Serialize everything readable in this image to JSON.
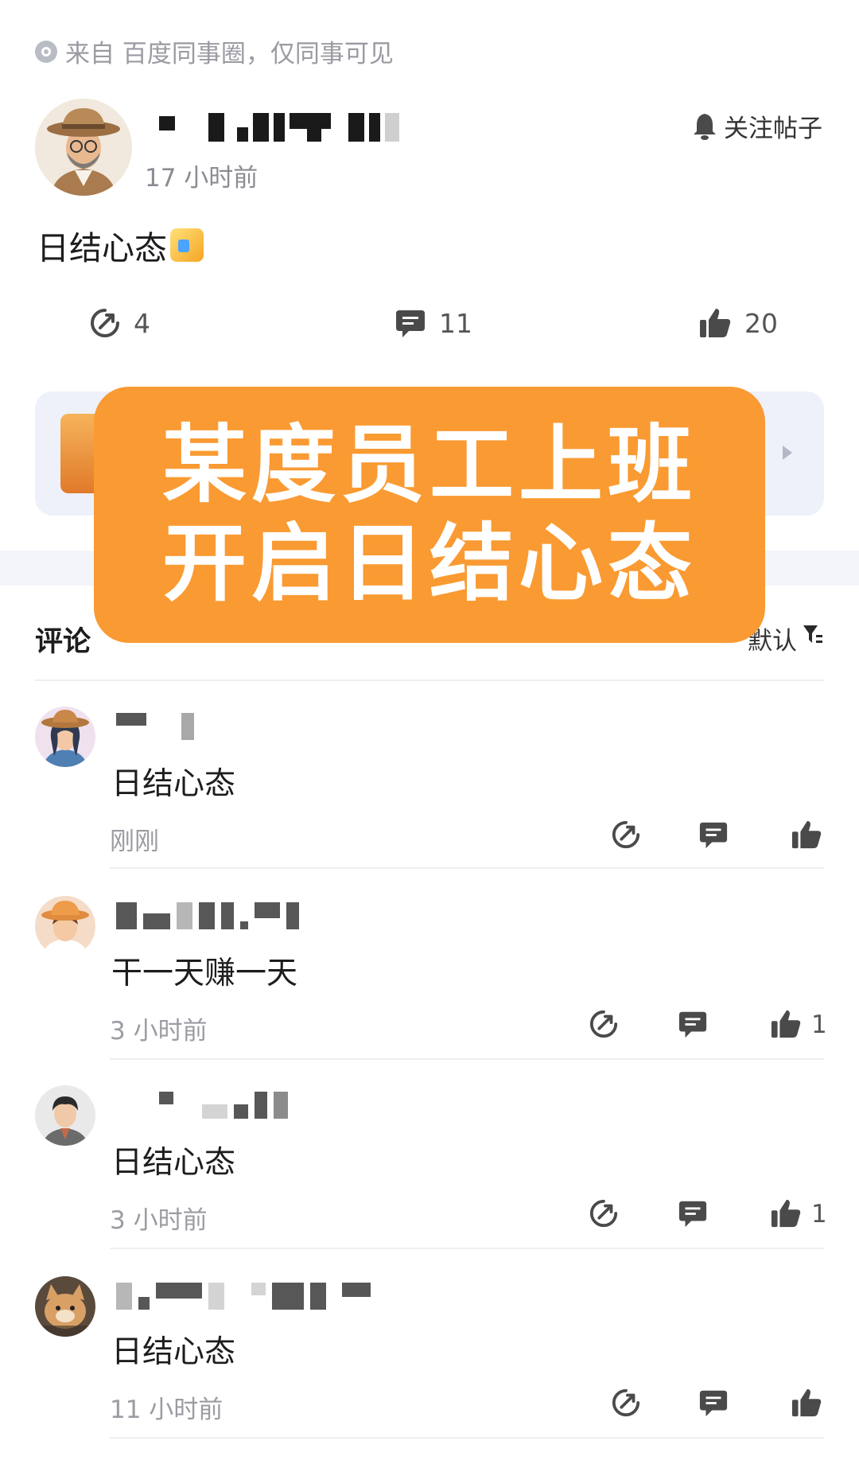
{
  "post": {
    "source": "来自 百度同事圈，仅同事可见",
    "time": "17 小时前",
    "follow_label": "关注帖子",
    "text": "日结心态",
    "share_count": "4",
    "comment_count": "11",
    "like_count": "20"
  },
  "overlay": {
    "line1": "某度员工上班",
    "line2": "开启日结心态"
  },
  "comments_section": {
    "title": "评论",
    "sort_label": "默认"
  },
  "comments": [
    {
      "text": "日结心态",
      "time": "刚刚",
      "likes": ""
    },
    {
      "text": "干一天赚一天",
      "time": "3 小时前",
      "likes": "1"
    },
    {
      "text": "日结心态",
      "time": "3 小时前",
      "likes": "1"
    },
    {
      "text": "日结心态",
      "time": "11 小时前",
      "likes": ""
    }
  ],
  "colors": {
    "overlay": "#fa9a32",
    "icon": "#4a4a4a"
  }
}
